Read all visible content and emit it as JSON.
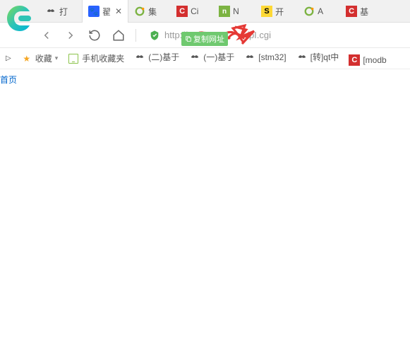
{
  "tabs": [
    {
      "label": "打",
      "icon": "wing"
    },
    {
      "label": "翟",
      "icon": "paw",
      "active": true
    },
    {
      "label": "集",
      "icon": "o-green"
    },
    {
      "label": "Ci",
      "icon": "c-red"
    },
    {
      "label": "N",
      "icon": "nvidia"
    },
    {
      "label": "开",
      "icon": "s-yellow"
    },
    {
      "label": "A",
      "icon": "o-green"
    },
    {
      "label": "基",
      "icon": "c-red"
    }
  ],
  "url_prefix": "http://10",
  "url_suffix": "/pI.cgi",
  "copy_tip": "复制网址",
  "bookmarks": {
    "expand": "▷",
    "fav": "收藏",
    "mobile": "手机收藏夹",
    "items": [
      {
        "label": "(二)基于",
        "icon": "wing"
      },
      {
        "label": "(一)基于",
        "icon": "wing"
      },
      {
        "label": "[stm32]",
        "icon": "wing"
      },
      {
        "label": "[转]qt中",
        "icon": "wing"
      },
      {
        "label": "[modb",
        "icon": "c-red"
      }
    ]
  },
  "page_link": "首页"
}
